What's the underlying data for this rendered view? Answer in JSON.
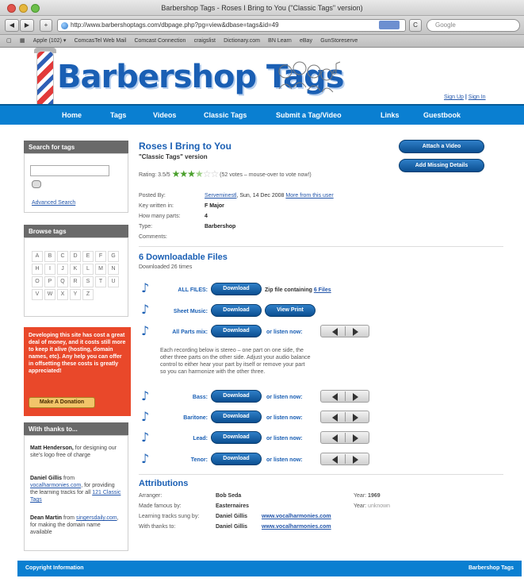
{
  "window": {
    "title": "Barbershop Tags - Roses I Bring to You (\"Classic Tags\" version)"
  },
  "toolbar": {
    "url": "http://www.barbershoptags.com/dbpage.php?pg=view&dbase=tags&id=49",
    "search_placeholder": "Google",
    "back": "◀",
    "forward": "▶",
    "add": "+",
    "reload": "C"
  },
  "bookmarks": [
    "Apple (102) ▾",
    "ComcasTel Web Mail",
    "Comcast Connection",
    "craigslist",
    "Dictionary.com",
    "BN Learn",
    "eBay",
    "GunStoreserve"
  ],
  "header": {
    "logo_text": "Barbershop Tags",
    "sign_up": "Sign Up",
    "separator": "|",
    "sign_in": "Sign In"
  },
  "nav": [
    {
      "label": "Home"
    },
    {
      "label": "Tags"
    },
    {
      "label": "Videos"
    },
    {
      "label": "Classic Tags"
    },
    {
      "label": "Submit a Tag/Video"
    },
    {
      "label": "Links"
    },
    {
      "label": "Guestbook"
    }
  ],
  "sidebar": {
    "search_title": "Search for tags",
    "advanced_search": "Advanced Search",
    "browse_title": "Browse tags",
    "letters": [
      "A",
      "B",
      "C",
      "D",
      "E",
      "F",
      "G",
      "H",
      "I",
      "J",
      "K",
      "L",
      "M",
      "N",
      "O",
      "P",
      "Q",
      "R",
      "S",
      "T",
      "U",
      "V",
      "W",
      "X",
      "Y",
      "Z"
    ],
    "donate_text": "Developing this site has cost a great deal of money, and it costs still more to keep it alive (hosting, domain names, etc). Any help you can offer in offsetting these costs is greatly appreciated!",
    "donate_button": "Make A Donation",
    "thanks_title": "With thanks to...",
    "thanks": [
      {
        "name": "Matt Henderson,",
        "text": "for designing our site's logo free of charge"
      },
      {
        "name": "Daniel Gillis",
        "pre": "from",
        "link": "vocalharmonies.com",
        "text": ", for providing the learning tracks for all",
        "link2": "121 Classic Tags"
      },
      {
        "name": "Dean Martin",
        "pre": "from",
        "link": "singersdaily.com",
        "text": ", for making the domain name available"
      }
    ]
  },
  "song": {
    "title": "Roses I Bring to You",
    "subtitle": "\"Classic Tags\" version",
    "rating_label": "Rating: 3.5/5",
    "votes_text": "(52 votes – mouse-over to vote now!)",
    "stars_full": "★★★",
    "stars_half": "★",
    "stars_empty": "☆☆",
    "rating_value": 3.5,
    "attach_video": "Attach a Video",
    "add_missing": "Add Missing Details",
    "info": [
      {
        "label": "Posted By:",
        "value_link": "Serveminestl",
        "value": ", Sun, 14 Dec 2008",
        "extra_link": "More from this user"
      },
      {
        "label": "Key written in:",
        "value": "F Major"
      },
      {
        "label": "How many parts:",
        "value": "4"
      },
      {
        "label": "Type:",
        "value": "Barbershop"
      },
      {
        "label": "Comments:",
        "value": ""
      }
    ]
  },
  "downloads": {
    "title": "6 Downloadable Files",
    "subtitle": "Downloaded 26 times",
    "download_label": "Download",
    "view_print": "View Print",
    "listen_label": "or listen now:",
    "all_files": {
      "label": "ALL FILES:",
      "zip_text": "Zip file containing",
      "zip_link": "6 Files"
    },
    "sheet_music": {
      "label": "Sheet Music:"
    },
    "all_parts": {
      "label": "All Parts mix:"
    },
    "explain": "Each recording below is stereo – one part on one side, the other three parts on the other side. Adjust your audio balance control to either hear your part by itself or remove your part so you can harmonize with the other three.",
    "parts": [
      {
        "label": "Bass:"
      },
      {
        "label": "Baritone:"
      },
      {
        "label": "Lead:"
      },
      {
        "label": "Tenor:"
      }
    ]
  },
  "attributions": {
    "title": "Attributions",
    "rows": [
      {
        "label": "Arranger:",
        "value": "Bob Seda",
        "year_label": "Year:",
        "year": "1969"
      },
      {
        "label": "Made famous by:",
        "value": "Easternaires",
        "year_label": "Year:",
        "year": "unknown"
      },
      {
        "label": "Learning tracks sung by:",
        "value": "Daniel Gillis",
        "link": "www.vocalharmonies.com"
      },
      {
        "label": "With thanks to:",
        "value": "Daniel Gillis",
        "link": "www.vocalharmonies.com"
      }
    ]
  },
  "footer": {
    "left": "Copyright Information",
    "right": "Barbershop Tags"
  }
}
